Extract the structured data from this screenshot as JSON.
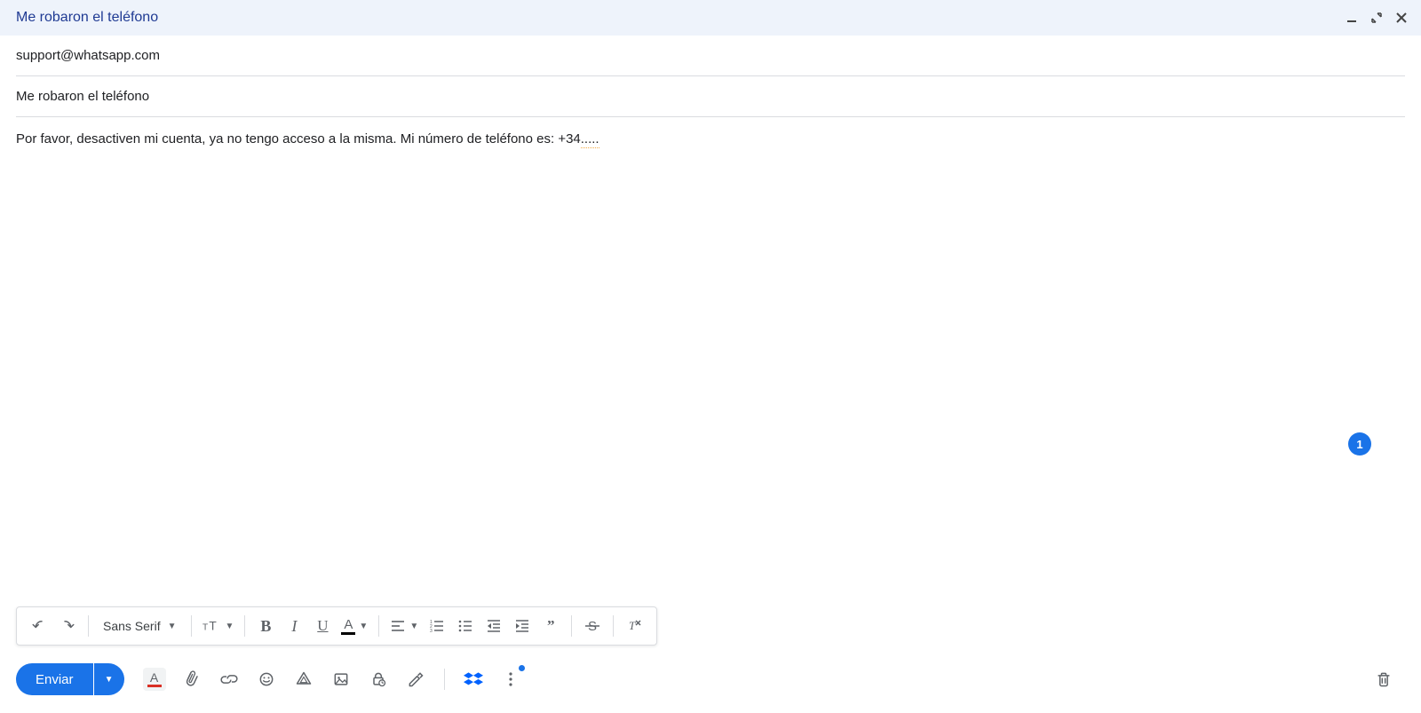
{
  "header": {
    "title": "Me robaron el teléfono"
  },
  "to_field": {
    "value": "support@whatsapp.com"
  },
  "subject_field": {
    "value": "Me robaron el teléfono"
  },
  "body": {
    "text_part1": "Por favor, desactiven mi cuenta, ya no tengo acceso a la misma. Mi número de teléfono es: +34",
    "text_underlined": "....."
  },
  "format_toolbar": {
    "font_name": "Sans Serif"
  },
  "send": {
    "label": "Enviar"
  },
  "chat_badge": {
    "count": "1"
  }
}
